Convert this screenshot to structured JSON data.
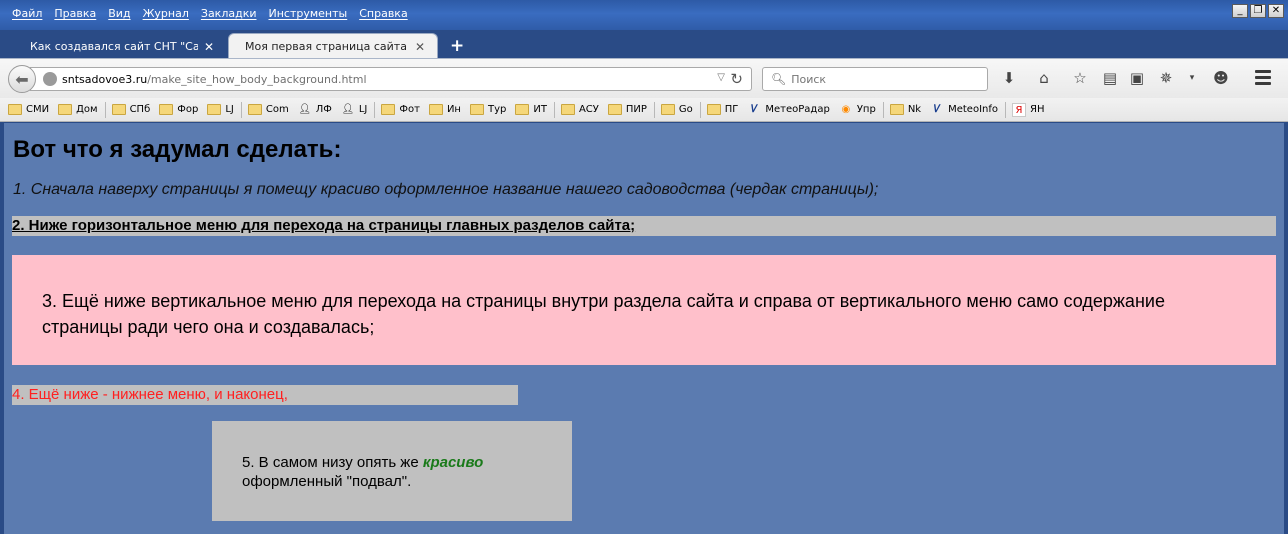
{
  "menubar": {
    "items": [
      "Файл",
      "Правка",
      "Вид",
      "Журнал",
      "Закладки",
      "Инструменты",
      "Справка"
    ]
  },
  "tabs": [
    {
      "label": "Как создавался сайт СНТ \"Садо...",
      "active": false
    },
    {
      "label": "Моя первая страница сайта",
      "active": true
    }
  ],
  "urlbar": {
    "domain": "sntsadovoe3.ru",
    "path": "/make_site_how_body_background.html"
  },
  "search": {
    "placeholder": "Поиск"
  },
  "bookmarks": [
    {
      "label": "СМИ",
      "icon": "folder-icon"
    },
    {
      "label": "Дом",
      "icon": "folder-icon"
    },
    {
      "label": "СПб",
      "icon": "folder-icon"
    },
    {
      "label": "Фор",
      "icon": "folder-icon"
    },
    {
      "label": "LJ",
      "icon": "folder-icon"
    },
    {
      "label": "Com",
      "icon": "folder-icon"
    },
    {
      "label": "ЛФ",
      "icon": "user-icon"
    },
    {
      "label": "LJ",
      "icon": "user-icon"
    },
    {
      "label": "Фот",
      "icon": "folder-icon"
    },
    {
      "label": "Ин",
      "icon": "folder-icon"
    },
    {
      "label": "Тур",
      "icon": "folder-icon"
    },
    {
      "label": "ИТ",
      "icon": "folder-icon"
    },
    {
      "label": "АСУ",
      "icon": "folder-icon"
    },
    {
      "label": "ПИР",
      "icon": "folder-icon"
    },
    {
      "label": "Go",
      "icon": "folder-icon"
    },
    {
      "label": "ПГ",
      "icon": "folder-icon"
    },
    {
      "label": "МетеоРадар",
      "icon": "weather-icon"
    },
    {
      "label": "Упр",
      "icon": "rss-icon"
    },
    {
      "label": "Nk",
      "icon": "folder-icon"
    },
    {
      "label": "MeteoInfo",
      "icon": "weather-icon"
    },
    {
      "label": "ЯН",
      "icon": "yandex-icon"
    }
  ],
  "page": {
    "heading": "Вот что я задумал сделать:",
    "item1": "1. Сначала наверху страницы я помещу красиво оформленное название нашего садоводства (чердак страницы);",
    "item2": "2. Ниже горизонтальное меню для перехода на страницы главных разделов сайта;",
    "item3": "3. Ещё ниже вертикальное меню для перехода на страницы внутри раздела сайта и справа от вертикального меню само содержание страницы ради чего она и создавалась;",
    "item4": "4. Ещё ниже - нижнее меню, и наконец,",
    "footer_before": "5. В самом низу опять же",
    "footer_emph": "красиво",
    "footer_after": "оформленный \"подвал\"."
  },
  "colors": {
    "page_background": "#5b7bb0",
    "block_grey": "#c0c0c0",
    "block_pink": "#ffc0cb",
    "item4_text": "#ff2020",
    "footer_emphasis": "#1a7a1a"
  }
}
